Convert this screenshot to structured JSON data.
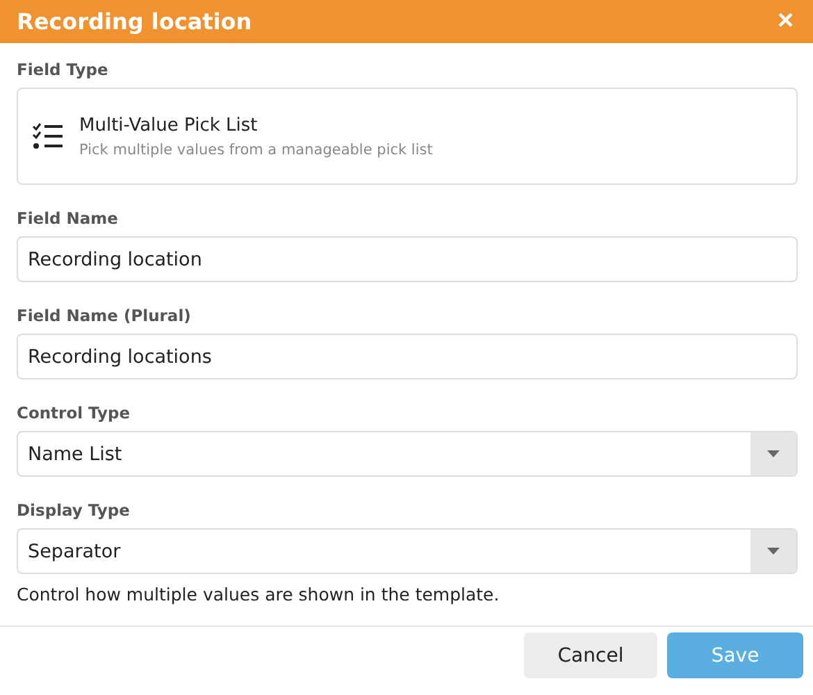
{
  "dialog": {
    "title": "Recording location",
    "close": "×"
  },
  "field_type": {
    "label": "Field Type",
    "name": "Multi-Value Pick List",
    "description": "Pick multiple values from a manageable pick list"
  },
  "fields": [
    {
      "kind": "text",
      "label": "Field Name",
      "value": "Recording location"
    },
    {
      "kind": "text",
      "label": "Field Name (Plural)",
      "value": "Recording locations"
    },
    {
      "kind": "select",
      "label": "Control Type",
      "value": "Name List"
    },
    {
      "kind": "select",
      "label": "Display Type",
      "value": "Separator",
      "help": "Control how multiple values are shown in the template."
    }
  ],
  "buttons": [
    {
      "kind": "secondary",
      "label": "Cancel"
    },
    {
      "kind": "primary",
      "label": "Save"
    }
  ]
}
